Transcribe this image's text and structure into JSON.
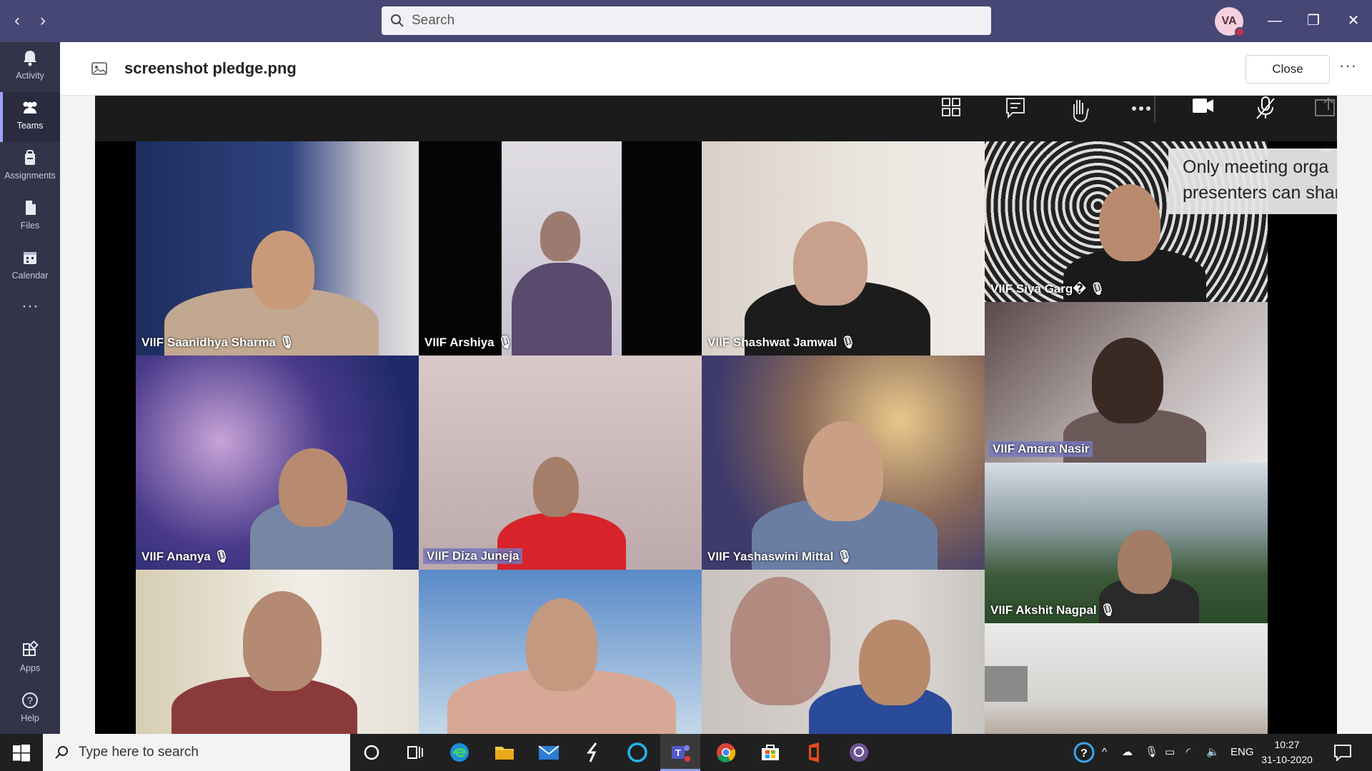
{
  "titlebar": {
    "search_placeholder": "Search",
    "avatar_initials": "VA",
    "back": "‹",
    "forward": "›"
  },
  "rail": [
    {
      "label": "Activity",
      "icon": "bell-icon"
    },
    {
      "label": "Teams",
      "icon": "teams-icon"
    },
    {
      "label": "Assignments",
      "icon": "assignments-icon"
    },
    {
      "label": "Files",
      "icon": "files-icon"
    },
    {
      "label": "Calendar",
      "icon": "calendar-icon"
    },
    {
      "label": "Apps",
      "icon": "apps-icon"
    },
    {
      "label": "Help",
      "icon": "help-icon"
    }
  ],
  "header": {
    "file_name": "screenshot pledge.png",
    "close_label": "Close",
    "more": "···"
  },
  "meeting": {
    "tooltip_line1": "Only meeting orga",
    "tooltip_line2": "presenters can shar",
    "participants": [
      {
        "name": "VIIF Saanidhya Sharma 🎙"
      },
      {
        "name": "VIIF Arshiya 🎙"
      },
      {
        "name": "VIIF Shashwat Jamwal 🎙"
      },
      {
        "name": "VIIF Siya Garg� 🎙"
      },
      {
        "name": "VIIF Amara Nasir"
      },
      {
        "name": "VIIF Ananya 🎙"
      },
      {
        "name": "VIIF Diza Juneja"
      },
      {
        "name": "VIIF Yashaswini Mittal 🎙"
      },
      {
        "name": "VIIF Akshit Nagpal 🎙"
      }
    ]
  },
  "taskbar": {
    "search_placeholder": "Type here to search",
    "language": "ENG",
    "time": "10:27",
    "date": "31-10-2020"
  },
  "colors": {
    "titlebar": "#464775",
    "rail": "#33344a",
    "accent": "#9ea2ff"
  }
}
